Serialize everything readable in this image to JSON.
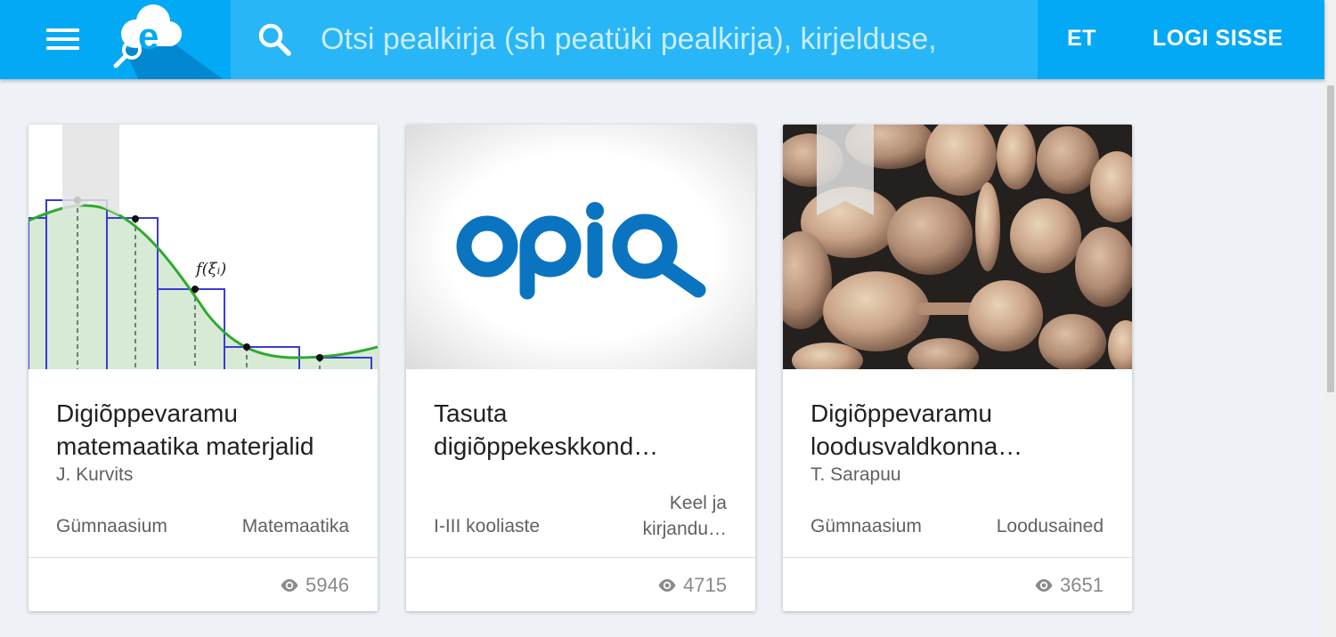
{
  "header": {
    "search": {
      "placeholder": "Otsi pealkirja (sh peatüki pealkirja), kirjelduse,"
    },
    "language_label": "ET",
    "login_label": "LOGI SISSE"
  },
  "colors": {
    "header_bg": "#03a9f4",
    "search_bg": "#29b6f6",
    "opiq_blue": "#0a74c0"
  },
  "cards": [
    {
      "title_line1": "Digiõppevaramu",
      "title_line2": "matemaatika materjalid",
      "author": "J. Kurvits",
      "level": "Gümnaasium",
      "subject": "Matemaatika",
      "views": "5946",
      "function_label": "f(ξᵢ)",
      "image": "riemann-sum-graph"
    },
    {
      "title_line1": "Tasuta",
      "title_line2": "digiõppekeskkond…",
      "author": "",
      "level": "I-III kooliaste",
      "subject_line1": "Keel ja",
      "subject_line2": "kirjandu…",
      "views": "4715",
      "logo_text": "OPIQ",
      "image": "opiq-logo"
    },
    {
      "title_line1": "Digiõppevaramu",
      "title_line2": "loodusvaldkonna…",
      "author": "T. Sarapuu",
      "level": "Gümnaasium",
      "subject": "Loodusained",
      "views": "3651",
      "image": "yeast-cells-micrograph"
    }
  ]
}
